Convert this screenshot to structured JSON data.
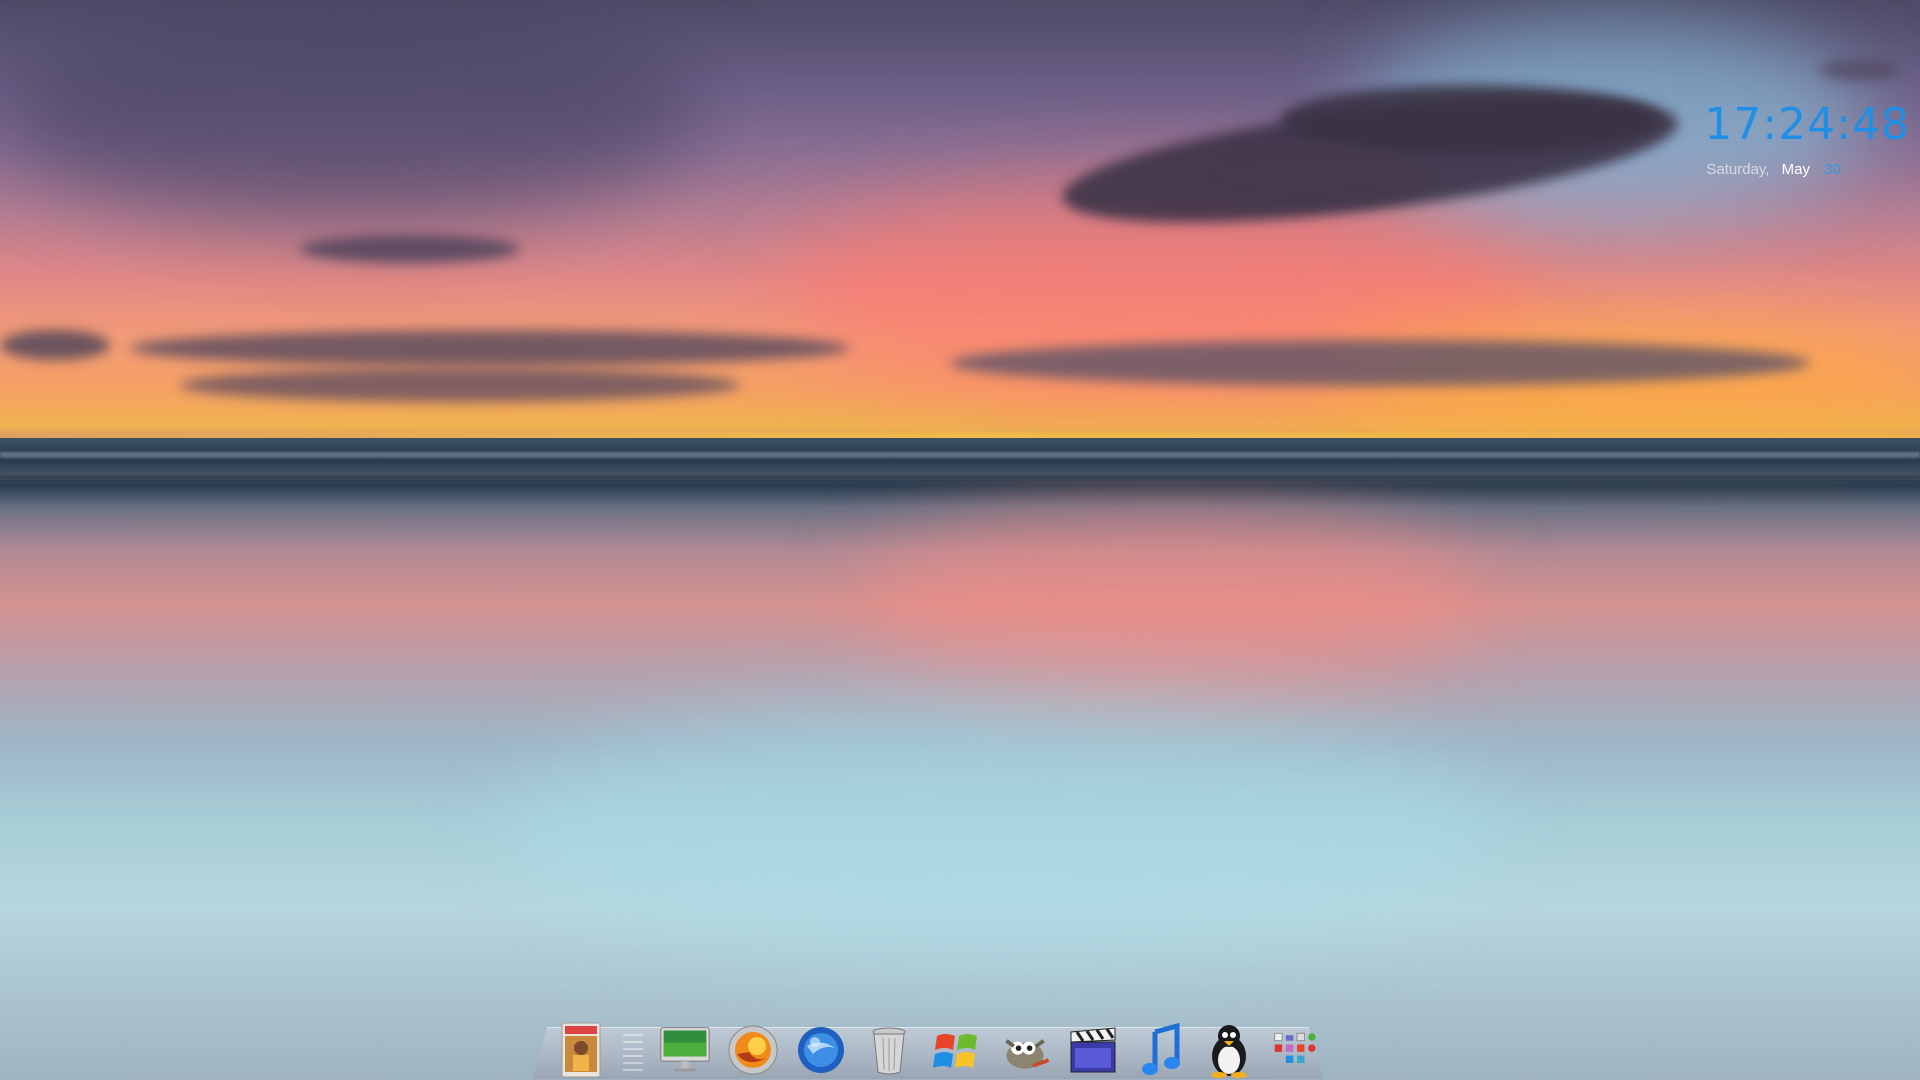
{
  "clock": {
    "time": "17:24:48",
    "weekday": "Saturday,",
    "month": "May",
    "day": "30"
  },
  "dock": {
    "items": [
      {
        "name": "nba-2k10-game-icon"
      },
      {
        "name": "separator"
      },
      {
        "name": "imac-computer-icon"
      },
      {
        "name": "firefox-icon"
      },
      {
        "name": "thunderbird-icon"
      },
      {
        "name": "trash-icon"
      },
      {
        "name": "windows-icon"
      },
      {
        "name": "gimp-icon"
      },
      {
        "name": "video-clapper-icon"
      },
      {
        "name": "itunes-music-icon"
      },
      {
        "name": "linux-tux-icon"
      },
      {
        "name": "applications-stack-icon"
      }
    ]
  },
  "colors": {
    "clock_time": "#1f8fe6",
    "clock_day": "#3a96e0"
  }
}
